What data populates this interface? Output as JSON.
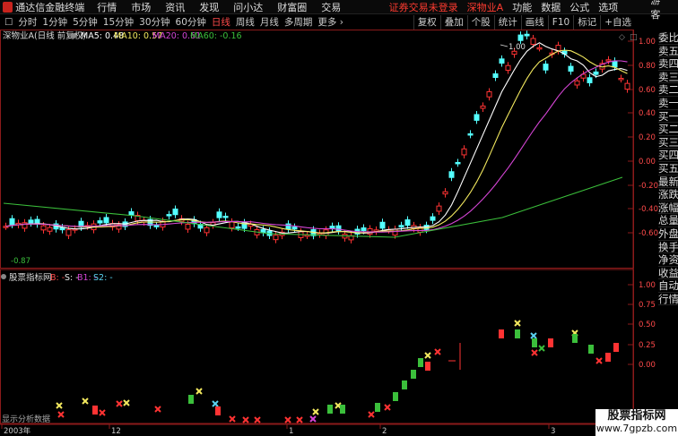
{
  "titlebar": {
    "app_title": "通达信金融终端",
    "menus": [
      "行情",
      "市场",
      "资讯",
      "发现",
      "问小达",
      "财富圈",
      "交易"
    ],
    "login_warning": "证券交易未登录",
    "stock_link": "深物业A",
    "right_menus": [
      "功能",
      "数据",
      "公式",
      "选项"
    ],
    "guest": "游客"
  },
  "toolbar": {
    "checkbox": "☐",
    "periods": [
      "分时",
      "1分钟",
      "5分钟",
      "15分钟",
      "30分钟",
      "60分钟",
      "日线",
      "周线",
      "月线",
      "多周期",
      "更多 ›"
    ],
    "active_period": "日线",
    "right_buttons": [
      "复权",
      "叠加",
      "个股",
      "统计",
      "画线",
      "F10",
      "标记",
      "+自选"
    ]
  },
  "side_tabs": [
    "委比",
    "卖五",
    "卖四",
    "卖三",
    "卖二",
    "卖一",
    "买一",
    "买二",
    "买三",
    "买四",
    "买五",
    "最新",
    "涨跌",
    "涨幅",
    "总量",
    "外盘",
    "换手",
    "净资",
    "收益",
    "自动",
    "行情"
  ],
  "main_panel": {
    "header": "深物业A(日线 前复权)",
    "ma_labels": [
      {
        "text": "MA5: 0.48",
        "color": "#ffffff"
      },
      {
        "text": "MA10: 0.57",
        "color": "#f2e85e"
      },
      {
        "text": "MA20: 0.61",
        "color": "#d545d5"
      },
      {
        "text": "MA60: -0.16",
        "color": "#3bbf3b"
      }
    ],
    "y_ticks": [
      "1.00",
      "0.80",
      "0.60",
      "0.40",
      "0.20",
      "0.00",
      "-0.20",
      "-0.40",
      "-0.60"
    ],
    "high_label": "1.00",
    "low_label": "-0.87"
  },
  "indicator_panel": {
    "header": "股票指标网",
    "series_labels": [
      {
        "text": "B: -",
        "color": "#ff4a4a"
      },
      {
        "text": "S: -",
        "color": "#e8e8e8"
      },
      {
        "text": "B1: -",
        "color": "#d545d5"
      },
      {
        "text": "S2: -",
        "color": "#5ad2f0"
      }
    ],
    "y_ticks": [
      "1.00",
      "0.75",
      "0.50",
      "0.25",
      "0.00"
    ],
    "footer_text": "显示分析数据"
  },
  "x_axis": {
    "labels": [
      "2003年",
      "12",
      "1",
      "2",
      "3"
    ]
  },
  "watermark": {
    "title": "股票指标网",
    "url": "www.7gpzb.com"
  },
  "colors": {
    "up": "#ff3333",
    "down": "#54ffff",
    "ma5": "#ffffff",
    "ma10": "#f2e85e",
    "ma20": "#d545d5",
    "ma60": "#3bbf3b",
    "grid": "#8b1a1a"
  }
}
